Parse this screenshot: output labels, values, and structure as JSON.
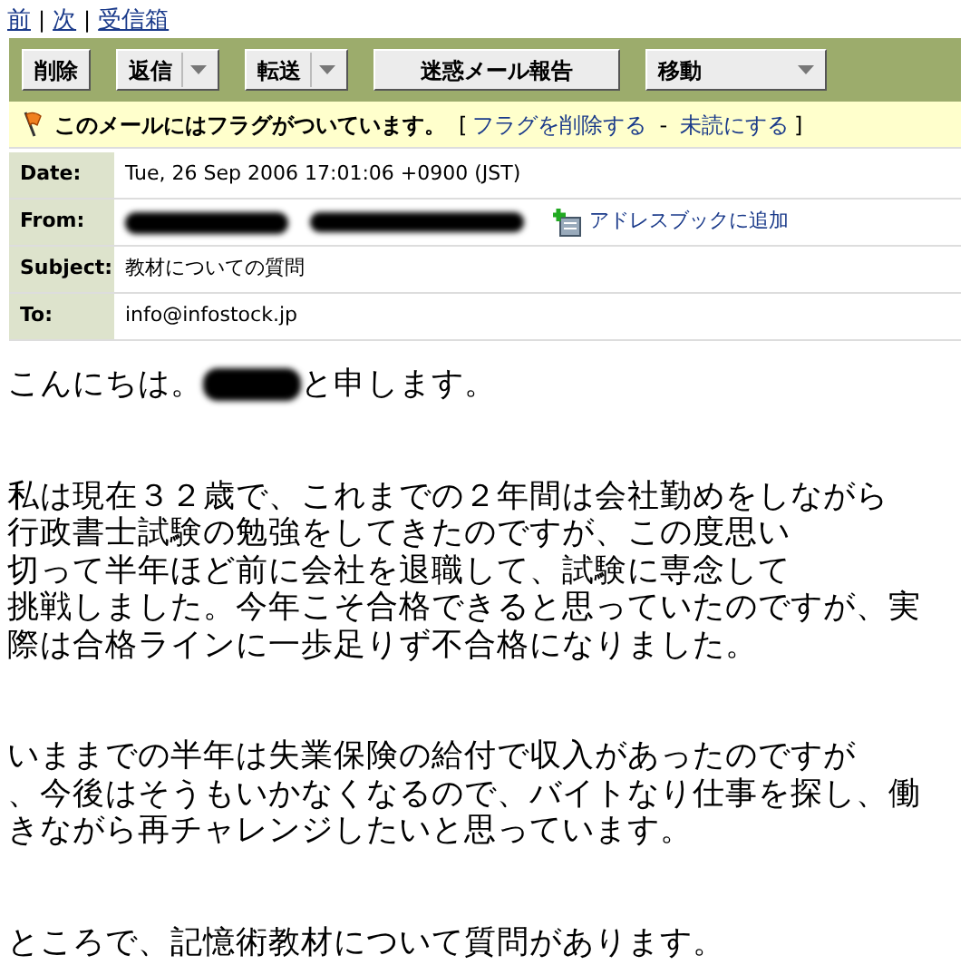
{
  "nav_links": [
    {
      "kind": "link",
      "label": "前"
    },
    {
      "kind": "separator",
      "label": "|"
    },
    {
      "kind": "link",
      "label": "次"
    },
    {
      "kind": "separator",
      "label": "|"
    },
    {
      "kind": "link",
      "label": "受信箱"
    }
  ],
  "toolbar": [
    {
      "label": "削除",
      "dropdown": false
    },
    {
      "label": "返信",
      "dropdown": true
    },
    {
      "label": "転送",
      "dropdown": true
    },
    {
      "label": "迷惑メール報告",
      "dropdown": false
    },
    {
      "label": "移動",
      "dropdown": true
    }
  ],
  "flag_notice": {
    "text": "このメールにはフラグがついています。",
    "open_bracket": "[",
    "links": [
      "フラグを削除する",
      "未読にする"
    ],
    "link_separator": "-",
    "close_bracket": "]"
  },
  "headers": [
    {
      "kind": "text",
      "label": "Date:",
      "value": "Tue, 26 Sep 2006 17:01:06 +0900 (JST)"
    },
    {
      "kind": "from",
      "label": "From:",
      "action": "アドレスブックに追加"
    },
    {
      "kind": "text",
      "label": "Subject:",
      "value": "教材についての質問"
    },
    {
      "kind": "text",
      "label": "To:",
      "value": "info@infostock.jp"
    }
  ],
  "body": [
    {
      "kind": "greeting",
      "before": "こんにちは。",
      "after": "と申します。"
    },
    {
      "kind": "paragraph",
      "lines": [
        "私は現在３２歳で、これまでの２年間は会社勤めをしながら",
        "行政書士試験の勉強をしてきたのですが、この度思い",
        "切って半年ほど前に会社を退職して、試験に専念して",
        "挑戦しました。今年こそ合格できると思っていたのですが、実",
        "際は合格ラインに一歩足りず不合格になりました。"
      ]
    },
    {
      "kind": "paragraph",
      "lines": [
        "いままでの半年は失業保険の給付で収入があったのですが",
        "、今後はそうもいかなくなるので、バイトなり仕事を探し、働",
        "きながら再チャレンジしたいと思っています。"
      ]
    },
    {
      "kind": "paragraph",
      "lines": [
        "ところで、記憶術教材について質問があります。"
      ]
    }
  ]
}
